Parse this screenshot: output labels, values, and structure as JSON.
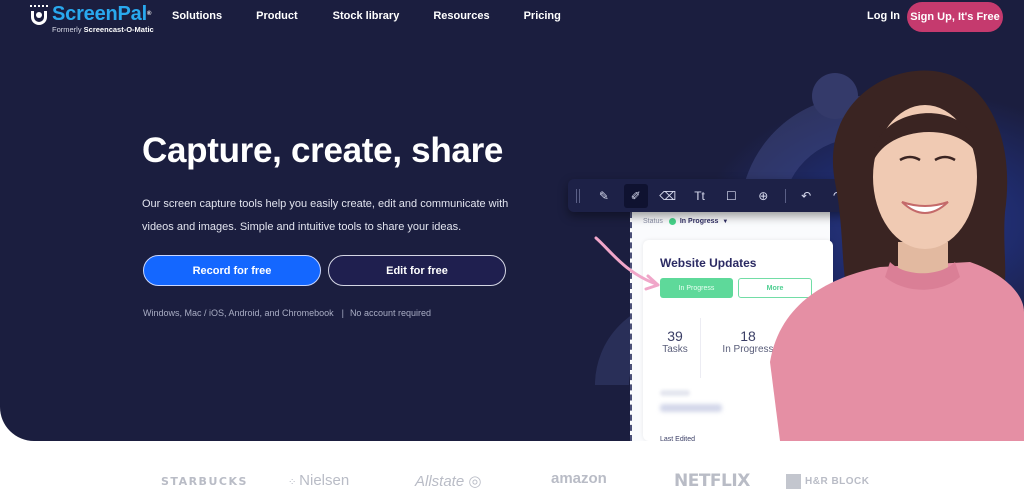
{
  "nav": {
    "brand_name": "ScreenPal",
    "brand_sub_prefix": "Formerly ",
    "brand_sub_name": "Screencast-O-Matic",
    "links": [
      {
        "label": "Solutions"
      },
      {
        "label": "Product"
      },
      {
        "label": "Stock library"
      },
      {
        "label": "Resources"
      },
      {
        "label": "Pricing"
      }
    ],
    "login_label": "Log In",
    "signup_label": "Sign Up, It's Free"
  },
  "hero": {
    "headline": "Capture, create, share",
    "subtext": "Our screen capture tools help you easily create, edit and communicate with videos and images. Simple and intuitive tools to share your ideas.",
    "record_button": "Record for free",
    "edit_button": "Edit for free",
    "platforms": "Windows, Mac / iOS, Android, and Chromebook",
    "separator": "|",
    "no_account": "No account required"
  },
  "mockup": {
    "toolbar_tools": [
      {
        "icon": "pen-icon",
        "glyph": "✎"
      },
      {
        "icon": "highlighter-icon",
        "glyph": "✐",
        "active": true
      },
      {
        "icon": "eraser-icon",
        "glyph": "⌫"
      },
      {
        "icon": "text-icon",
        "glyph": "Tt"
      },
      {
        "icon": "rectangle-icon",
        "glyph": "☐"
      },
      {
        "icon": "zoom-in-icon",
        "glyph": "⊕"
      },
      {
        "icon": "undo-icon",
        "glyph": "↶"
      },
      {
        "icon": "redo-icon",
        "glyph": "↷"
      }
    ],
    "status_label": "Status",
    "status_value": "In Progress",
    "card_title": "Website Updates",
    "pill_progress": "In Progress",
    "pill_more": "More",
    "stats": [
      {
        "value": "39",
        "label": "Tasks"
      },
      {
        "value": "18",
        "label": "In Progress"
      }
    ],
    "last_edited": "Last Edited"
  },
  "logos": [
    {
      "name": "STARBUCKS"
    },
    {
      "name": "Nielsen"
    },
    {
      "name": "Allstate"
    },
    {
      "name": "amazon"
    },
    {
      "name": "NETFLIX"
    },
    {
      "name": "H&R BLOCK"
    }
  ],
  "colors": {
    "hero_bg": "#1b1e3f",
    "brand_blue": "#29a9ee",
    "signup_pink": "#c53a6e",
    "record_blue": "#1467ff",
    "status_green": "#47d38a"
  }
}
